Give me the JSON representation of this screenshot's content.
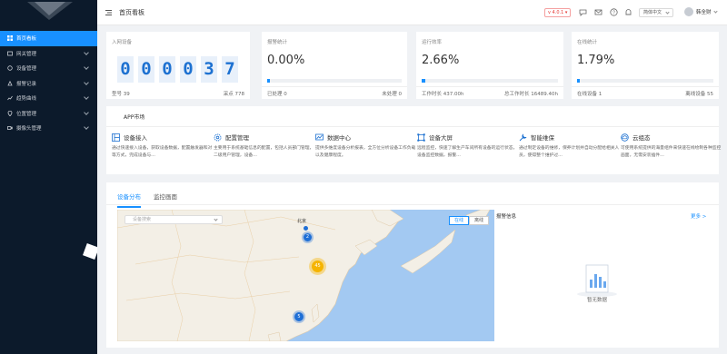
{
  "header": {
    "title": "首页看板",
    "version": "v 4.0.1",
    "language": "简体中文",
    "username": "韩全财"
  },
  "sidebar": {
    "items": [
      {
        "label": "首页看板",
        "icon": "home-icon",
        "active": true,
        "has_children": false
      },
      {
        "label": "网关管理",
        "icon": "gateway-icon",
        "active": false,
        "has_children": true
      },
      {
        "label": "设备管理",
        "icon": "device-icon",
        "active": false,
        "has_children": true
      },
      {
        "label": "报警记录",
        "icon": "alarm-icon",
        "active": false,
        "has_children": true
      },
      {
        "label": "趋势曲线",
        "icon": "chart-icon",
        "active": false,
        "has_children": true
      },
      {
        "label": "位置管理",
        "icon": "location-icon",
        "active": false,
        "has_children": true
      },
      {
        "label": "摄像头管理",
        "icon": "camera-icon",
        "active": false,
        "has_children": true
      }
    ]
  },
  "stats": {
    "device": {
      "label": "入网设备",
      "digits": [
        "0",
        "0",
        "0",
        "0",
        "3",
        "7"
      ],
      "left_text": "型号 39",
      "right_text": "采点 778"
    },
    "alarm": {
      "label": "报警统计",
      "value": "0.00%",
      "fraction": 0.0,
      "left_text": "已处理 0",
      "right_text": "未处理 0"
    },
    "runtime": {
      "label": "运行效率",
      "value": "2.66%",
      "fraction": 0.0266,
      "left_text": "工作时长 437.00h",
      "right_text": "总工作时长 16489.40h"
    },
    "online": {
      "label": "在线统计",
      "value": "1.79%",
      "fraction": 0.0179,
      "left_text": "在线设备 1",
      "right_text": "离线设备 55"
    }
  },
  "app_market": {
    "title": "APP市场",
    "items": [
      {
        "name": "设备接入",
        "icon": "device-access-icon",
        "desc": "通过快速接入设备，获取设备数据，配置触发器和对等方式，完成设备与…"
      },
      {
        "name": "配置管理",
        "icon": "gear-icon",
        "desc": "主要用于系统基础信息的配置，包括人员部门管理，二级用户管理，设备…"
      },
      {
        "name": "数据中心",
        "icon": "data-center-icon",
        "desc": "提供多维度设备分析报表，全方位分析设备工作负载以及健康程度。"
      },
      {
        "name": "设备大屏",
        "icon": "big-screen-icon",
        "desc": "远程监控，快速了解生产车间所有设备的运行状态，设备监控数据，报警…"
      },
      {
        "name": "智能维保",
        "icon": "maintenance-icon",
        "desc": "通过制定设备的维修，保养计划并自动分配给相关人员，使得整个维护过…"
      },
      {
        "name": "云组态",
        "icon": "cloud-icon",
        "desc": "可使用系统提供的海量组件来快速在线绘制各种监控画面，无需安装插件…"
      }
    ]
  },
  "bottom": {
    "tabs": [
      {
        "label": "设备分布",
        "active": true
      },
      {
        "label": "监控画面",
        "active": false
      }
    ],
    "map": {
      "search_placeholder": "设备搜索",
      "toggle": [
        "在线",
        "离线"
      ],
      "label_beijing": "北京",
      "clusters": [
        {
          "count": "2",
          "color": "#1f6fd6"
        },
        {
          "count": "45",
          "color": "#f5b400"
        },
        {
          "count": "5",
          "color": "#1f6fd6"
        }
      ]
    },
    "alarm": {
      "title": "报警信息",
      "more": "更多 >",
      "empty": "暂无数据"
    }
  },
  "colors": {
    "accent": "#1890ff",
    "sidebar_bg": "#0c1a2b",
    "digit_bg": "#e8f0fa",
    "digit_fg": "#1d71d1",
    "version_red": "#e53935"
  }
}
